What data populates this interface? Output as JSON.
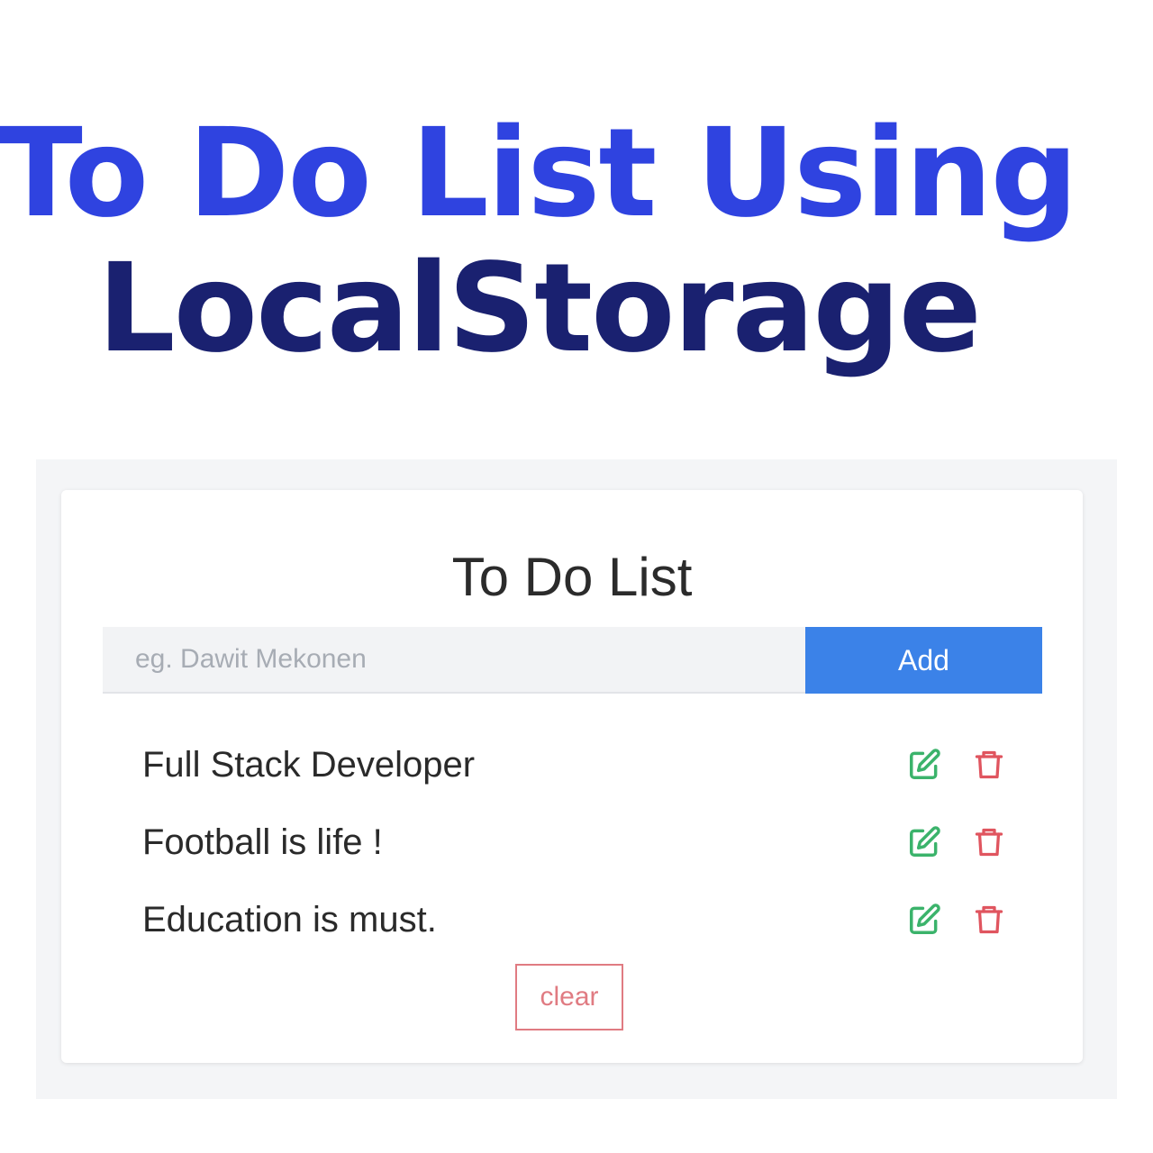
{
  "headline": {
    "line1": "To Do List Using",
    "line2": "LocalStorage"
  },
  "app": {
    "title": "To Do List",
    "input": {
      "placeholder": "eg. Dawit Mekonen",
      "value": ""
    },
    "add_label": "Add",
    "items": [
      {
        "text": "Full Stack Developer",
        "edit_icon": "edit-icon",
        "delete_icon": "trash-icon"
      },
      {
        "text": "Football is life !",
        "edit_icon": "edit-icon",
        "delete_icon": "trash-icon"
      },
      {
        "text": "Education is must.",
        "edit_icon": "edit-icon",
        "delete_icon": "trash-icon"
      }
    ],
    "clear_label": "clear"
  },
  "colors": {
    "headline_line1": "#2f43e0",
    "headline_line2": "#1a2170",
    "add_button": "#3b82e8",
    "edit_icon": "#3bb36b",
    "delete_icon": "#e0555f",
    "clear_button": "#e07b82"
  }
}
